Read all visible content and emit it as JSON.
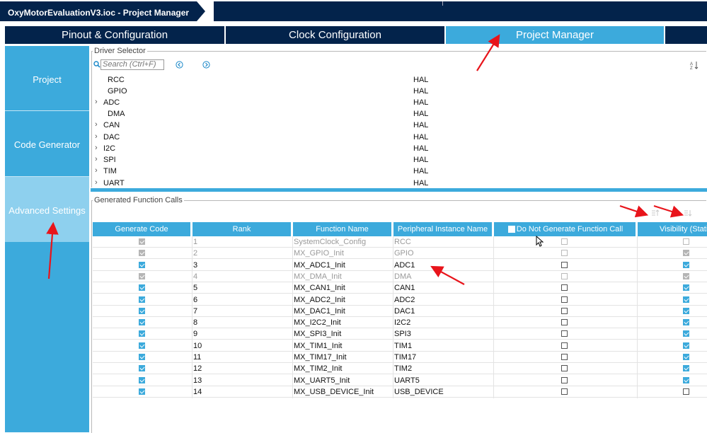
{
  "window": {
    "title": "OxyMotorEvaluationV3.ioc - Project Manager"
  },
  "tabs": [
    {
      "label": "Pinout & Configuration",
      "active": false
    },
    {
      "label": "Clock Configuration",
      "active": false
    },
    {
      "label": "Project Manager",
      "active": true
    }
  ],
  "sidebar": {
    "items": [
      {
        "label": "Project",
        "active": false
      },
      {
        "label": "Code Generator",
        "active": false
      },
      {
        "label": "Advanced Settings",
        "active": true
      }
    ]
  },
  "driver_selector": {
    "title": "Driver Selector",
    "search_placeholder": "Search (Ctrl+F)",
    "rows": [
      {
        "name": "RCC",
        "driver": "HAL",
        "expandable": false
      },
      {
        "name": "GPIO",
        "driver": "HAL",
        "expandable": false
      },
      {
        "name": "ADC",
        "driver": "HAL",
        "expandable": true
      },
      {
        "name": "DMA",
        "driver": "HAL",
        "expandable": false
      },
      {
        "name": "CAN",
        "driver": "HAL",
        "expandable": true
      },
      {
        "name": "DAC",
        "driver": "HAL",
        "expandable": true
      },
      {
        "name": "I2C",
        "driver": "HAL",
        "expandable": true
      },
      {
        "name": "SPI",
        "driver": "HAL",
        "expandable": true
      },
      {
        "name": "TIM",
        "driver": "HAL",
        "expandable": true
      },
      {
        "name": "UART",
        "driver": "HAL",
        "expandable": true
      }
    ]
  },
  "generated_calls": {
    "title": "Generated Function Calls",
    "columns": {
      "generate": "Generate Code",
      "rank": "Rank",
      "function": "Function Name",
      "instance": "Peripheral Instance Name",
      "donotgen": "Do Not Generate Function Call",
      "visibility": "Visibility (Stati"
    },
    "rows": [
      {
        "generate": true,
        "rank": "1",
        "function": "SystemClock_Config",
        "instance": "RCC",
        "donotgen": false,
        "visibility": null,
        "disabled": true
      },
      {
        "generate": true,
        "rank": "2",
        "function": "MX_GPIO_Init",
        "instance": "GPIO",
        "donotgen": false,
        "visibility": true,
        "disabled": true
      },
      {
        "generate": true,
        "rank": "3",
        "function": "MX_ADC1_Init",
        "instance": "ADC1",
        "donotgen": false,
        "visibility": true,
        "disabled": false
      },
      {
        "generate": true,
        "rank": "4",
        "function": "MX_DMA_Init",
        "instance": "DMA",
        "donotgen": false,
        "visibility": true,
        "disabled": true
      },
      {
        "generate": true,
        "rank": "5",
        "function": "MX_CAN1_Init",
        "instance": "CAN1",
        "donotgen": false,
        "visibility": true,
        "disabled": false
      },
      {
        "generate": true,
        "rank": "6",
        "function": "MX_ADC2_Init",
        "instance": "ADC2",
        "donotgen": false,
        "visibility": true,
        "disabled": false
      },
      {
        "generate": true,
        "rank": "7",
        "function": "MX_DAC1_Init",
        "instance": "DAC1",
        "donotgen": false,
        "visibility": true,
        "disabled": false
      },
      {
        "generate": true,
        "rank": "8",
        "function": "MX_I2C2_Init",
        "instance": "I2C2",
        "donotgen": false,
        "visibility": true,
        "disabled": false
      },
      {
        "generate": true,
        "rank": "9",
        "function": "MX_SPI3_Init",
        "instance": "SPI3",
        "donotgen": false,
        "visibility": true,
        "disabled": false
      },
      {
        "generate": true,
        "rank": "10",
        "function": "MX_TIM1_Init",
        "instance": "TIM1",
        "donotgen": false,
        "visibility": true,
        "disabled": false
      },
      {
        "generate": true,
        "rank": "11",
        "function": "MX_TIM17_Init",
        "instance": "TIM17",
        "donotgen": false,
        "visibility": true,
        "disabled": false
      },
      {
        "generate": true,
        "rank": "12",
        "function": "MX_TIM2_Init",
        "instance": "TIM2",
        "donotgen": false,
        "visibility": true,
        "disabled": false
      },
      {
        "generate": true,
        "rank": "13",
        "function": "MX_UART5_Init",
        "instance": "UART5",
        "donotgen": false,
        "visibility": true,
        "disabled": false
      },
      {
        "generate": true,
        "rank": "14",
        "function": "MX_USB_DEVICE_Init",
        "instance": "USB_DEVICE",
        "donotgen": false,
        "visibility": false,
        "disabled": false
      }
    ]
  },
  "icons": {
    "search": "search-icon",
    "prev": "chevron-left-circle-icon",
    "next": "chevron-right-circle-icon",
    "sort": "sort-az-icon",
    "move_up": "move-up-icon",
    "move_down": "move-down-icon"
  },
  "colors": {
    "navy": "#03234b",
    "accent": "#3caadc",
    "active_nav": "#8ed0ee",
    "annotation": "#e8141b"
  }
}
